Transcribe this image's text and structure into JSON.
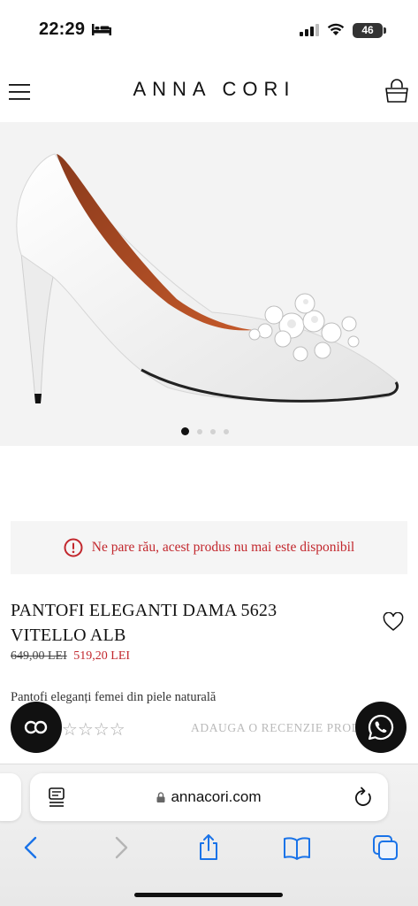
{
  "status_bar": {
    "time": "22:29",
    "battery": "46"
  },
  "header": {
    "brand": "ANNA CORI"
  },
  "gallery": {
    "slide_count": 4,
    "active_slide": 1
  },
  "notice": {
    "text": "Ne pare rău, acest produs nu mai este disponibil",
    "color": "#c2272d"
  },
  "product": {
    "title": "PANTOFI ELEGANTI DAMA 5623 VITELLO ALB",
    "old_price": "649,00 LEI",
    "new_price": "519,20 LEI",
    "description": "Pantofi eleganți femei din piele naturală",
    "rating_stars": "☆☆☆☆☆",
    "review_link": "ADAUGA O RECENZIE PRODUS"
  },
  "badges": {
    "left": "CO",
    "right": "whatsapp-icon"
  },
  "browser": {
    "url": "annacori.com"
  }
}
